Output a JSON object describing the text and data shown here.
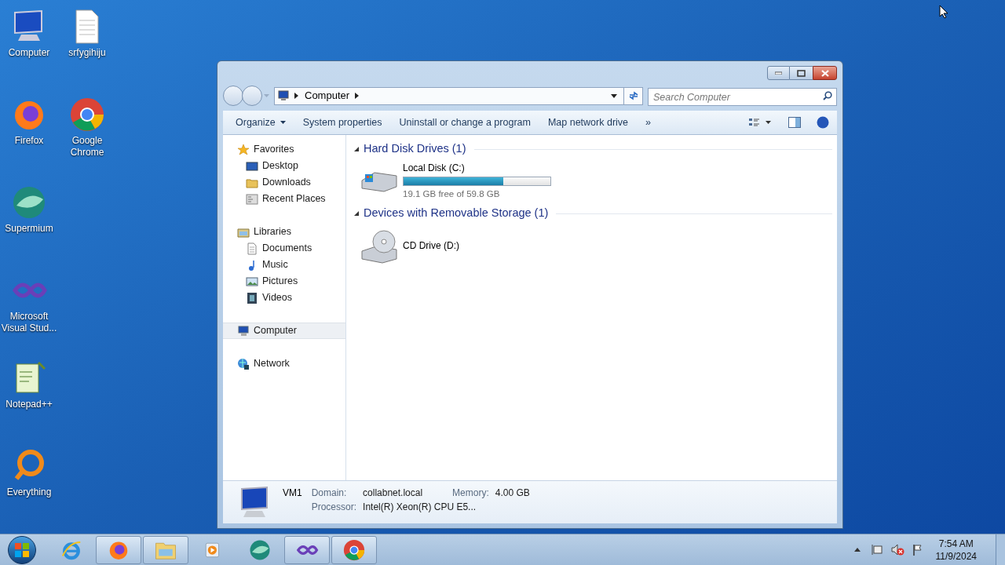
{
  "desktop_icons": [
    {
      "kind": "computer",
      "label": "Computer"
    },
    {
      "kind": "firefox",
      "label": "Firefox"
    },
    {
      "kind": "supermium",
      "label": "Supermium"
    },
    {
      "kind": "vs",
      "label": "Microsoft Visual Stud..."
    },
    {
      "kind": "notepad",
      "label": "Notepad++"
    },
    {
      "kind": "everything",
      "label": "Everything"
    },
    {
      "kind": "file",
      "label": "srfygihiju"
    },
    {
      "kind": "chrome",
      "label": "Google Chrome"
    }
  ],
  "window": {
    "address": {
      "crumb": "Computer"
    },
    "search": {
      "placeholder": "Search Computer"
    },
    "toolbar": [
      {
        "label": "Organize",
        "dropdown": true
      },
      {
        "label": "System properties",
        "dropdown": false
      },
      {
        "label": "Uninstall or change a program",
        "dropdown": false
      },
      {
        "label": "Map network drive",
        "dropdown": false
      },
      {
        "label": "»",
        "dropdown": false
      }
    ],
    "nav": [
      {
        "kind": "star",
        "label": "Favorites",
        "selected": false,
        "children": [
          {
            "kind": "desktop",
            "label": "Desktop",
            "selected": false
          },
          {
            "kind": "folder",
            "label": "Downloads",
            "selected": false
          },
          {
            "kind": "recent",
            "label": "Recent Places",
            "selected": false
          }
        ]
      },
      {
        "kind": "libraries",
        "label": "Libraries",
        "selected": false,
        "children": [
          {
            "kind": "document",
            "label": "Documents",
            "selected": false
          },
          {
            "kind": "music",
            "label": "Music",
            "selected": false
          },
          {
            "kind": "pictures",
            "label": "Pictures",
            "selected": false
          },
          {
            "kind": "videos",
            "label": "Videos",
            "selected": false
          }
        ]
      },
      {
        "kind": "computer",
        "label": "Computer",
        "selected": true
      },
      {
        "kind": "network",
        "label": "Network",
        "selected": false
      }
    ],
    "sections": [
      {
        "title": "Hard Disk Drives (1)",
        "items": [
          {
            "kind": "disk",
            "name": "Local Disk (C:)",
            "level": 0.68,
            "free_text": "19.1 GB free of 59.8 GB"
          }
        ]
      },
      {
        "title": "Devices with Removable Storage (1)",
        "items": [
          {
            "kind": "cd",
            "name": "CD Drive (D:)"
          }
        ]
      }
    ],
    "details": {
      "name": "VM1",
      "fields": [
        {
          "label": "Domain:",
          "value": "collabnet.local"
        },
        {
          "label": "Memory:",
          "value": "4.00 GB"
        },
        {
          "label": "Processor:",
          "value": "Intel(R) Xeon(R) CPU E5..."
        }
      ]
    }
  },
  "taskbar": {
    "apps": [
      {
        "kind": "ie",
        "running": false
      },
      {
        "kind": "firefox",
        "running": true
      },
      {
        "kind": "explorer",
        "running": true
      },
      {
        "kind": "media",
        "running": false
      },
      {
        "kind": "supermium",
        "running": false
      },
      {
        "kind": "vs",
        "running": true
      },
      {
        "kind": "chrome",
        "running": true
      }
    ],
    "clock": {
      "time": "7:54 AM",
      "date": "11/9/2024"
    }
  }
}
